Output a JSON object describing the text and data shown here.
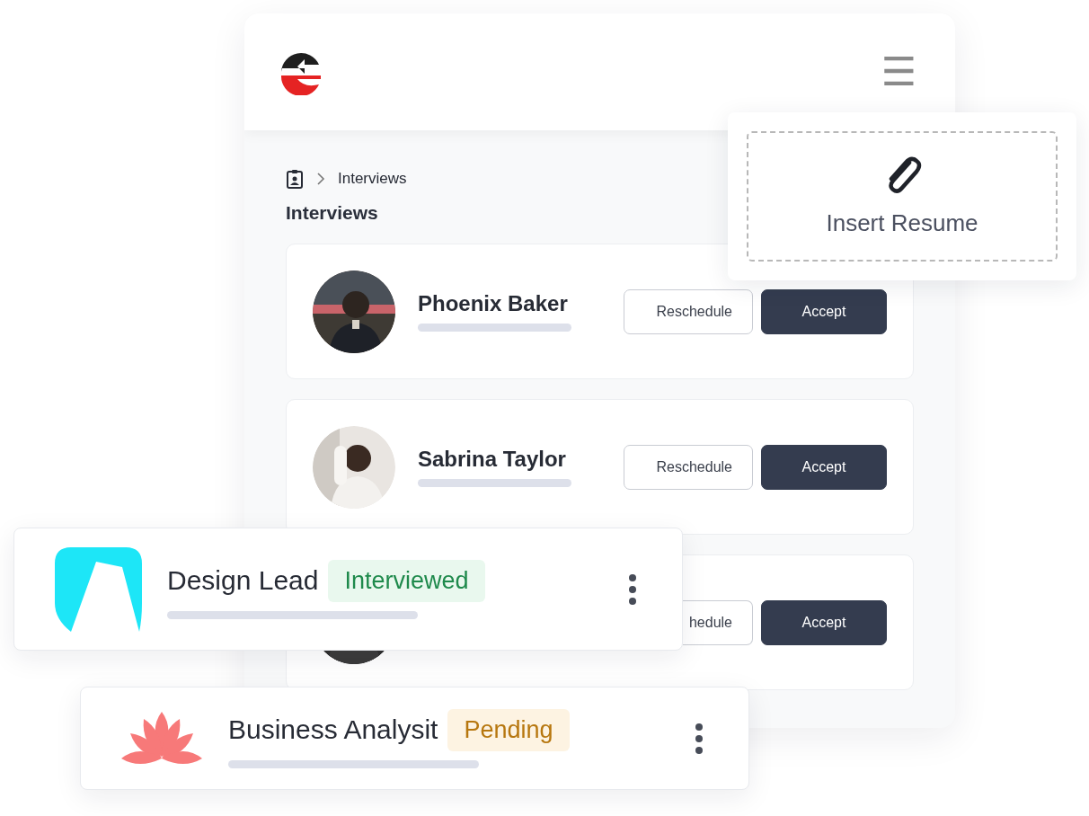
{
  "header": {
    "menu_icon": "☰"
  },
  "breadcrumb": {
    "current": "Interviews"
  },
  "title": "Interviews",
  "candidates": [
    {
      "name": "Phoenix Baker",
      "buttons": [
        {
          "label": "Reschedule",
          "kind": "outline"
        },
        {
          "label": "Accept",
          "kind": "primary"
        }
      ]
    },
    {
      "name": "Sabrina Taylor",
      "buttons": [
        {
          "label": "Reschedule",
          "kind": "outline"
        },
        {
          "label": "Accept",
          "kind": "primary"
        }
      ]
    },
    {
      "buttons": [
        {
          "label": "hedule",
          "kind": "outline-cut"
        },
        {
          "label": "Accept",
          "kind": "primary"
        }
      ]
    }
  ],
  "resume_drop": {
    "label": "Insert Resume"
  },
  "jobs": [
    {
      "title": "Design Lead",
      "kind": "arch",
      "status": {
        "label": "Interviewed",
        "kind": "success"
      }
    },
    {
      "title": "Business Analysit",
      "kind": "lotus",
      "status": {
        "label": "Pending",
        "kind": "warning"
      }
    }
  ]
}
